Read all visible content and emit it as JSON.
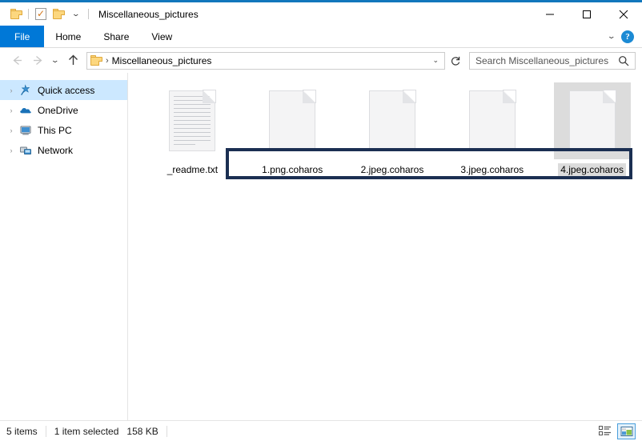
{
  "window": {
    "title": "Miscellaneous_pictures",
    "accent_color": "#1277bc",
    "minimize_label": "Minimize",
    "maximize_label": "Maximize",
    "close_label": "Close"
  },
  "quick_access_toolbar": {
    "items": [
      {
        "name": "folder-properties",
        "icon": "folder-icon"
      },
      {
        "name": "properties",
        "icon": "properties-checklist-icon"
      },
      {
        "name": "new-folder",
        "icon": "folder-icon"
      },
      {
        "name": "customize",
        "icon": "chevron-down-icon"
      }
    ]
  },
  "ribbon": {
    "tabs": [
      {
        "label": "File",
        "active": true
      },
      {
        "label": "Home",
        "active": false
      },
      {
        "label": "Share",
        "active": false
      },
      {
        "label": "View",
        "active": false
      }
    ],
    "collapse_label": "Minimize the Ribbon",
    "help_label": "?"
  },
  "navigation": {
    "back_label": "Back",
    "forward_label": "Forward",
    "recent_label": "Recent locations",
    "up_label": "Up to Miscellaneous_pictures",
    "breadcrumb": {
      "separator": "›",
      "items": [
        "Miscellaneous_pictures"
      ]
    },
    "history_chevron": "⌄",
    "refresh_label": "Refresh"
  },
  "search": {
    "placeholder": "Search Miscellaneous_pictures",
    "value": "",
    "icon": "search-icon"
  },
  "sidebar": {
    "items": [
      {
        "label": "Quick access",
        "icon": "star-pin-icon",
        "selected": true,
        "expander": "›"
      },
      {
        "label": "OneDrive",
        "icon": "cloud-icon",
        "selected": false,
        "expander": "›"
      },
      {
        "label": "This PC",
        "icon": "monitor-icon",
        "selected": false,
        "expander": "›"
      },
      {
        "label": "Network",
        "icon": "network-icon",
        "selected": false,
        "expander": "›"
      }
    ]
  },
  "files": [
    {
      "name": "_readme.txt",
      "icon": "text-document-icon",
      "selected": false
    },
    {
      "name": "1.png.coharos",
      "icon": "generic-document-icon",
      "selected": false
    },
    {
      "name": "2.jpeg.coharos",
      "icon": "generic-document-icon",
      "selected": false
    },
    {
      "name": "3.jpeg.coharos",
      "icon": "generic-document-icon",
      "selected": false
    },
    {
      "name": "4.jpeg.coharos",
      "icon": "generic-document-icon",
      "selected": true
    }
  ],
  "annotation": {
    "color": "#1b2f52",
    "description": "Encrypted files highlight box"
  },
  "status_bar": {
    "item_count": "5 items",
    "selection": "1 item selected",
    "size": "158 KB",
    "views": [
      {
        "name": "details-view",
        "active": false
      },
      {
        "name": "large-icons-view",
        "active": true
      }
    ]
  }
}
